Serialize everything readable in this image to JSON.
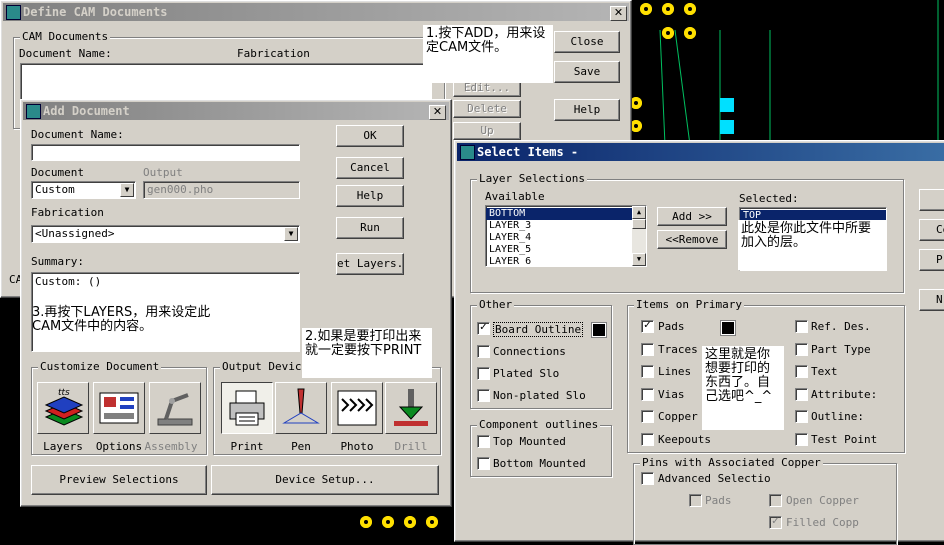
{
  "colors": {
    "title_active": "#0a246a",
    "title_inactive": "#808080",
    "dialog_bg": "#d4d0c8",
    "pcb_pad": "#ffe000",
    "pcb_cyan": "#00e0ff",
    "pcb_trace": "#00c060"
  },
  "define_cam": {
    "title": "Define CAM Documents",
    "group_label": "CAM Documents",
    "col_name": "Document Name:",
    "col_fab": "Fabrication",
    "buttons": {
      "close": "Close",
      "save": "Save",
      "edit": "Edit...",
      "delete": "Delete",
      "up": "Up",
      "help": "Help"
    },
    "partial_left": "CA"
  },
  "add_document": {
    "title": "Add Document",
    "doc_name_label": "Document Name:",
    "doc_name_value": "",
    "document_label": "Document",
    "document_value": "Custom",
    "output_label": "Output",
    "output_value": "gen000.pho",
    "fabrication_label": "Fabrication",
    "fabrication_value": "<Unassigned>",
    "summary_label": "Summary:",
    "summary_value": "Custom: ()",
    "buttons": {
      "ok": "OK",
      "cancel": "Cancel",
      "help": "Help",
      "run": "Run",
      "set_layers": "et Layers..",
      "preview": "Preview Selections",
      "device_setup": "Device Setup..."
    },
    "customize_group": "Customize Document",
    "customize_items": [
      {
        "label": "Layers"
      },
      {
        "label": "Options"
      },
      {
        "label": "Assembly"
      }
    ],
    "output_group": "Output Device",
    "output_items": [
      {
        "label": "Print"
      },
      {
        "label": "Pen"
      },
      {
        "label": "Photo"
      },
      {
        "label": "Drill"
      }
    ]
  },
  "select_items": {
    "title": "Select Items -",
    "layer_group": "Layer Selections",
    "available_label": "Available",
    "available_items": [
      "BOTTOM",
      "LAYER_3",
      "LAYER_4",
      "LAYER_5",
      "LAYER_6"
    ],
    "selected_label": "Selected:",
    "selected_items": [
      "TOP"
    ],
    "add_button": "Add >>",
    "remove_button": "<<Remove",
    "other_group": "Other",
    "other_items": [
      {
        "label": "Board Outline",
        "checked": true
      },
      {
        "label": "Connections",
        "checked": false
      },
      {
        "label": "Plated Slo",
        "checked": false
      },
      {
        "label": "Non-plated Slo",
        "checked": false
      }
    ],
    "component_group": "Component outlines",
    "component_items": [
      {
        "label": "Top Mounted",
        "checked": false
      },
      {
        "label": "Bottom Mounted",
        "checked": false
      }
    ],
    "primary_group": "Items on Primary",
    "primary_left": [
      {
        "label": "Pads",
        "checked": true
      },
      {
        "label": "Traces",
        "checked": false
      },
      {
        "label": "Lines",
        "checked": false
      },
      {
        "label": "Vias",
        "checked": false
      },
      {
        "label": "Copper",
        "checked": false
      },
      {
        "label": "Keepouts",
        "checked": false
      }
    ],
    "primary_right": [
      {
        "label": "Ref. Des.",
        "checked": false
      },
      {
        "label": "Part Type",
        "checked": false
      },
      {
        "label": "Text",
        "checked": false
      },
      {
        "label": "Attribute:",
        "checked": false
      },
      {
        "label": "Outline:",
        "checked": false
      },
      {
        "label": "Test Point",
        "checked": false
      }
    ],
    "pins_group": "Pins with Associated Copper",
    "pins_items": [
      {
        "label": "Advanced Selectio",
        "checked": false
      },
      {
        "label": "Pads",
        "checked": false
      },
      {
        "label": "Open Copper",
        "checked": false
      },
      {
        "label": "Filled Copp",
        "checked": true
      }
    ],
    "right_edge_buttons": [
      "Ce",
      "Pr",
      "N"
    ]
  },
  "notes": {
    "n1": "1.按下ADD，用来设定CAM文件。",
    "n2": "2.如果是要打印出来就一定要按下PRINT",
    "n3": "3.再按下LAYERS，用来设定此CAM文件中的内容。",
    "n4": "此处是你此文件中所要加入的层。",
    "n5": "这里就是你想要打印的东西了。自己选吧^_^"
  }
}
